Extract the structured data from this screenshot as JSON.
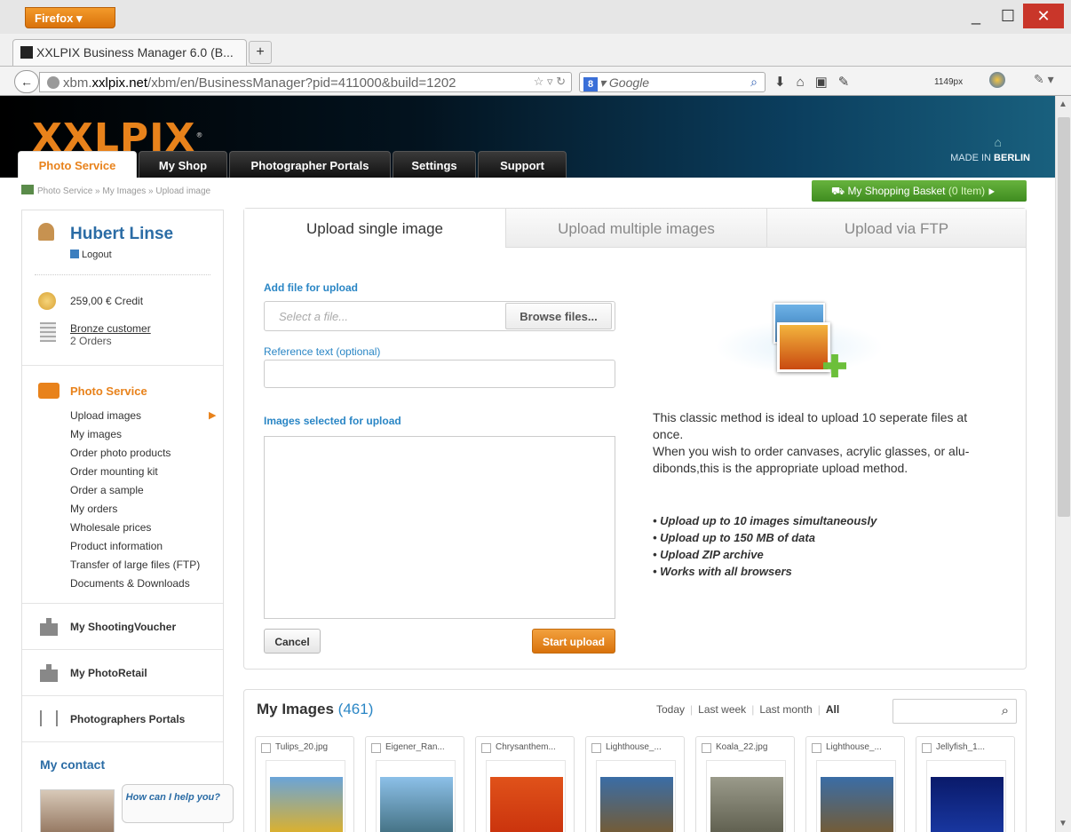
{
  "browser": {
    "menu_label": "Firefox",
    "tab_title": "XXLPIX Business Manager 6.0 (B...",
    "new_tab": "+",
    "url_prefix": "xbm.",
    "url_domain": "xxlpix.net",
    "url_path": "/xbm/en/BusinessManager?pid=411000&build=1202",
    "search_placeholder": "Google",
    "search_engine_badge": "8",
    "zoom_label": "1149px",
    "window_controls": {
      "minimize": "_",
      "maximize": "☐",
      "close": "✕"
    }
  },
  "site": {
    "logo": "XXLPIX",
    "made_in_prefix": "MADE IN",
    "made_in_city": "BERLIN",
    "main_tabs": [
      {
        "label": "Photo Service",
        "active": true
      },
      {
        "label": "My Shop"
      },
      {
        "label": "Photographer Portals"
      },
      {
        "label": "Settings"
      },
      {
        "label": "Support"
      }
    ],
    "breadcrumb": "Photo Service » My Images » Upload image",
    "basket_label": "My Shopping Basket",
    "basket_count": "(0 Item)",
    "basket_arrow": "▸"
  },
  "sidebar": {
    "user_name": "Hubert Linse",
    "logout": "Logout",
    "credit": "259,00 € Credit",
    "customer_level": "Bronze customer",
    "orders": "2 Orders",
    "photo_service_title": "Photo Service",
    "nav_items": [
      "Upload images",
      "My images",
      "Order photo products",
      "Order mounting kit",
      "Order a sample",
      "My orders",
      "Wholesale prices",
      "Product information",
      "Transfer of large files (FTP)",
      "Documents & Downloads"
    ],
    "sections": [
      "My ShootingVoucher",
      "My PhotoRetail",
      "Photographers Portals"
    ],
    "my_contact": "My contact",
    "help_bubble": "How can I help you?"
  },
  "upload": {
    "tabs": [
      "Upload single image",
      "Upload multiple images",
      "Upload via FTP"
    ],
    "add_file_label": "Add file for upload",
    "file_placeholder": "Select a file...",
    "browse_button": "Browse files...",
    "reference_label": "Reference text (optional)",
    "selected_label": "Images selected for upload",
    "cancel_button": "Cancel",
    "start_button": "Start upload",
    "description_1": "This classic method is ideal to upload 10 seperate files at once.",
    "description_2": "When you wish to order canvases, acrylic glasses, or alu-dibonds,this is the appropriate upload method.",
    "bullets": [
      "Upload up to 10 images simultaneously",
      "Upload up to 150 MB of data",
      "Upload ZIP archive",
      "Works with all browsers"
    ]
  },
  "my_images": {
    "title": "My Images",
    "count": "(461)",
    "filters": [
      "Today",
      "Last week",
      "Last month",
      "All"
    ],
    "thumbnails": [
      {
        "name": "Tulips_20.jpg",
        "color_top": "#6aa4d8",
        "color_bottom": "#e8b21a"
      },
      {
        "name": "Eigener_Ran...",
        "color_top": "#8cc0e8",
        "color_bottom": "#3d6a7a"
      },
      {
        "name": "Chrysanthem...",
        "color_top": "#e0521a",
        "color_bottom": "#c8300c"
      },
      {
        "name": "Lighthouse_...",
        "color_top": "#3a6da6",
        "color_bottom": "#7a5a2a"
      },
      {
        "name": "Koala_22.jpg",
        "color_top": "#9a9a8a",
        "color_bottom": "#5a5a4a"
      },
      {
        "name": "Lighthouse_...",
        "color_top": "#3a6da6",
        "color_bottom": "#7a5a2a"
      },
      {
        "name": "Jellyfish_1...",
        "color_top": "#0a1a6a",
        "color_bottom": "#1a3aa6"
      }
    ]
  },
  "colors": {
    "accent": "#e8821b",
    "link_blue": "#2a86c5",
    "basket_green": "#4f9e2b"
  }
}
